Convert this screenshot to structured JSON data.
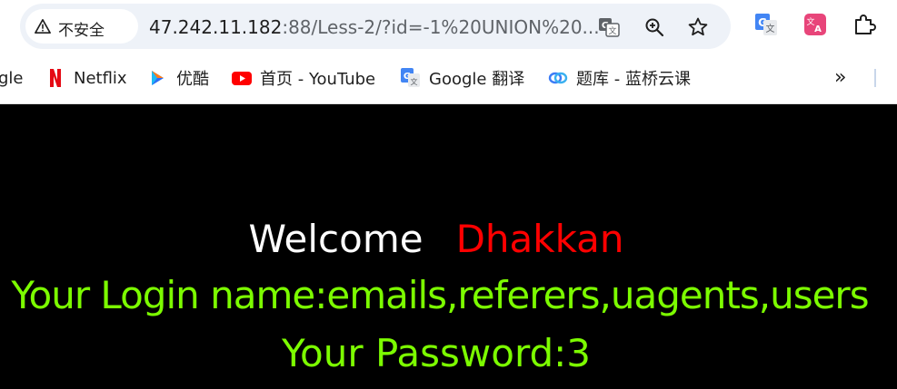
{
  "address_bar": {
    "security_label": "不安全",
    "url_host": "47.242.11.182",
    "url_rest": ":88/Less-2/?id=-1%20UNION%20..."
  },
  "bookmarks": [
    {
      "label": "gle",
      "icon": "google-icon"
    },
    {
      "label": "Netflix",
      "icon": "netflix-icon"
    },
    {
      "label": "优酷",
      "icon": "youku-icon"
    },
    {
      "label": "首页 - YouTube",
      "icon": "youtube-icon"
    },
    {
      "label": "Google 翻译",
      "icon": "google-translate-icon"
    },
    {
      "label": "题库 - 蓝桥云课",
      "icon": "lanqiao-icon"
    }
  ],
  "bookmarks_more": "»",
  "page": {
    "welcome": "Welcome",
    "name": "Dhakkan",
    "login_line": "Your Login name:emails,referers,uagents,users",
    "password_line": "Your Password:3"
  },
  "colors": {
    "background": "#000000",
    "welcome": "#ffffff",
    "name": "#ff0000",
    "result": "#7cfc00"
  }
}
